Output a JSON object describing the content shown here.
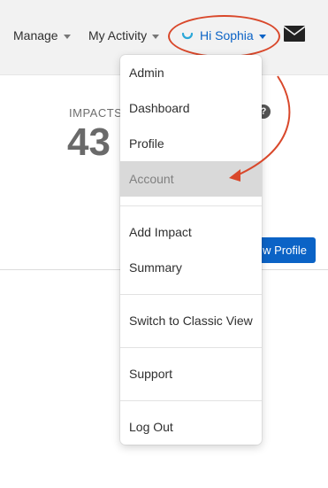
{
  "nav": {
    "manage": "Manage",
    "my_activity": "My Activity",
    "greeting": "Hi Sophia"
  },
  "stats": {
    "impacts_label": "IMPACTS",
    "impacts_value": "43",
    "help_glyph": "?"
  },
  "profile_button": "w Profile",
  "menu": {
    "items": [
      "Admin",
      "Dashboard",
      "Profile",
      "Account",
      "Add Impact",
      "Summary",
      "Switch to Classic View",
      "Support",
      "Log Out"
    ],
    "active_item": "Account"
  },
  "colors": {
    "accent": "#0b63c6",
    "annotation": "#d9482b",
    "navbar_bg": "#f2f2f2",
    "active_row": "#d9d9d9"
  },
  "icons": {
    "user": "user-icon",
    "mail": "mail-icon",
    "caret": "caret-down-icon",
    "help": "help-icon"
  }
}
